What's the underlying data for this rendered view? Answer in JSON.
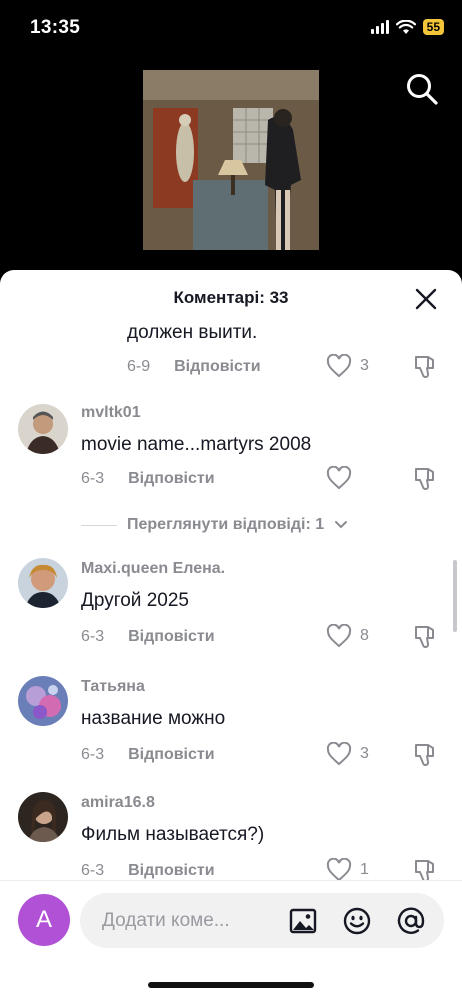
{
  "status_bar": {
    "time": "13:35",
    "battery": "55"
  },
  "sheet": {
    "title": "Коментарі: 33"
  },
  "comments": [
    {
      "text": "должен выити.",
      "date": "6-9",
      "reply_label": "Відповісти",
      "likes": "3"
    },
    {
      "username": "mvltk01",
      "text": "movie name...martyrs 2008",
      "date": "6-3",
      "reply_label": "Відповісти",
      "likes": ""
    },
    {
      "username": "Maxi.queen Елена.",
      "text": "Другой 2025",
      "date": "6-3",
      "reply_label": "Відповісти",
      "likes": "8"
    },
    {
      "username": "Татьяна",
      "text": "название можно",
      "date": "6-3",
      "reply_label": "Відповісти",
      "likes": "3"
    },
    {
      "username": "amira16.8",
      "text": "Фильм называется?)",
      "date": "6-3",
      "reply_label": "Відповісти",
      "likes": "1"
    }
  ],
  "view_replies": {
    "label": "Переглянути відповіді: 1"
  },
  "input": {
    "avatar_letter": "A",
    "placeholder": "Додати коме..."
  },
  "icons": [
    "search-icon",
    "close-icon",
    "heart-icon",
    "dislike-icon",
    "image-icon",
    "emoji-icon",
    "mention-icon",
    "chevron-down-icon"
  ]
}
